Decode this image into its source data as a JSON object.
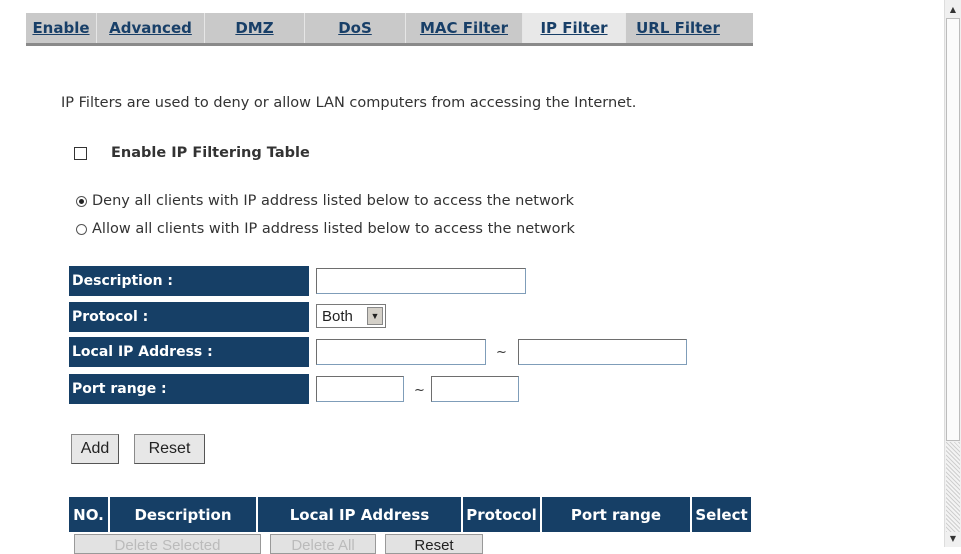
{
  "tabs": [
    {
      "label": "Enable",
      "active": false
    },
    {
      "label": "Advanced",
      "active": false
    },
    {
      "label": "DMZ",
      "active": false
    },
    {
      "label": "DoS",
      "active": false
    },
    {
      "label": "MAC Filter",
      "active": false
    },
    {
      "label": "IP Filter",
      "active": true
    },
    {
      "label": "URL Filter",
      "active": false
    }
  ],
  "intro_text": "IP Filters are used to deny or allow LAN computers from accessing the Internet.",
  "enable_filtering": {
    "label": "Enable IP Filtering Table",
    "checked": false
  },
  "policy": [
    {
      "label": "Deny all clients with IP address listed below to access the network",
      "selected": true
    },
    {
      "label": "Allow all clients with IP address listed below to access the network",
      "selected": false
    }
  ],
  "form": {
    "description_label": "Description :",
    "description_value": "",
    "protocol_label": "Protocol :",
    "protocol_value": "Both",
    "local_ip_label": "Local IP Address :",
    "local_ip_start": "",
    "local_ip_end": "",
    "port_range_label": "Port range :",
    "port_start": "",
    "port_end": "",
    "separator": "~"
  },
  "buttons": {
    "add": "Add",
    "reset": "Reset"
  },
  "table": {
    "headers": [
      "NO.",
      "Description",
      "Local IP Address",
      "Protocol",
      "Port range",
      "Select"
    ]
  },
  "table_buttons": {
    "delete_selected": "Delete Selected",
    "delete_all": "Delete All",
    "reset": "Reset"
  },
  "colors": {
    "header_bg": "#163f66",
    "tab_text": "#183f68"
  }
}
